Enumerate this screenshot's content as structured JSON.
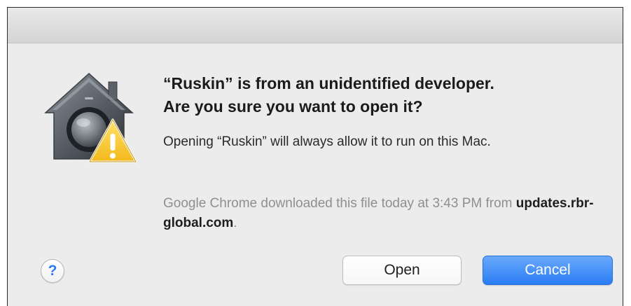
{
  "dialog": {
    "heading_line1": "“Ruskin” is from an unidentified developer.",
    "heading_line2": "Are you sure you want to open it?",
    "message": "Opening “Ruskin” will always allow it to run on this Mac.",
    "source_prefix": "Google Chrome downloaded this file today at 3:43 PM from ",
    "source_domain": "updates.rbr-global.com",
    "source_suffix": ".",
    "icon": "gatekeeper-house-warning-icon",
    "help_label": "?",
    "open_label": "Open",
    "cancel_label": "Cancel"
  },
  "colors": {
    "dialog_background": "#ececec",
    "default_button": "#2b7df5",
    "help_glyph": "#2f7bf5",
    "secondary_text": "#8f8f8f",
    "warning_yellow": "#f7c52c"
  }
}
